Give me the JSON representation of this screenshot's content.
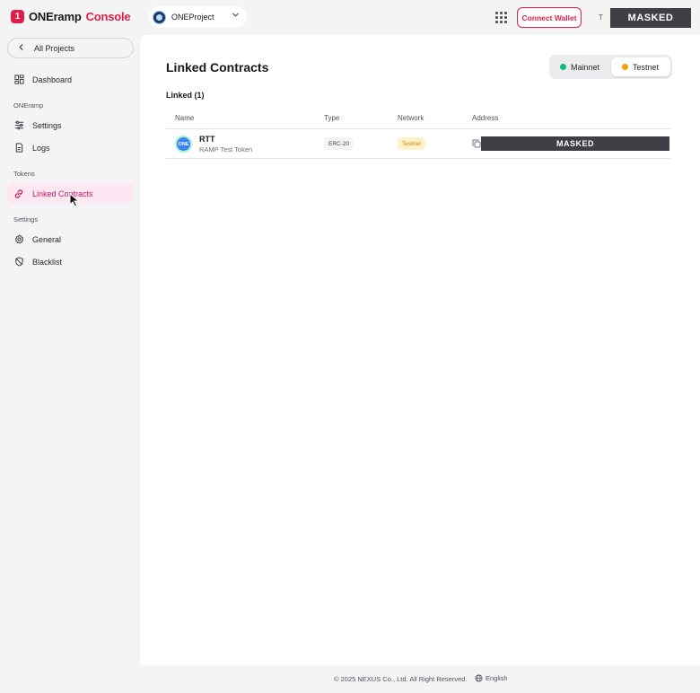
{
  "header": {
    "logo_badge": "1",
    "logo_text": "ONEramp",
    "logo_accent": "Console",
    "project_name": "ONEProject",
    "connect_wallet_label": "Connect Wallet",
    "user_initial": "T",
    "user_masked": "MASKED"
  },
  "sidebar": {
    "back_label": "All Projects",
    "dashboard_label": "Dashboard",
    "section_oneramp": "ONEramp",
    "settings_label": "Settings",
    "logs_label": "Logs",
    "section_tokens": "Tokens",
    "linked_contracts_label": "Linked Contracts",
    "section_settings": "Settings",
    "general_label": "General",
    "blacklist_label": "Blacklist"
  },
  "main": {
    "title": "Linked Contracts",
    "network_toggle": {
      "mainnet": "Mainnet",
      "testnet": "Testnet",
      "selected": "Testnet"
    },
    "linked_count": "Linked (1)",
    "table": {
      "columns": [
        "Name",
        "Type",
        "Network",
        "Address"
      ],
      "rows": [
        {
          "icon_text": "ONE",
          "symbol": "RTT",
          "name": "RAMP Test Token",
          "type": "ERC-20",
          "network": "Testnet",
          "address": "MASKED"
        }
      ]
    }
  },
  "footer": {
    "copyright": "© 2025 NEXUS Co., Ltd. All Right Reserved.",
    "language": "English"
  },
  "colors": {
    "brand": "#e11d48",
    "active_bg": "#fce7f3",
    "mainnet_dot": "#10b981",
    "testnet_dot": "#f59e0b"
  }
}
